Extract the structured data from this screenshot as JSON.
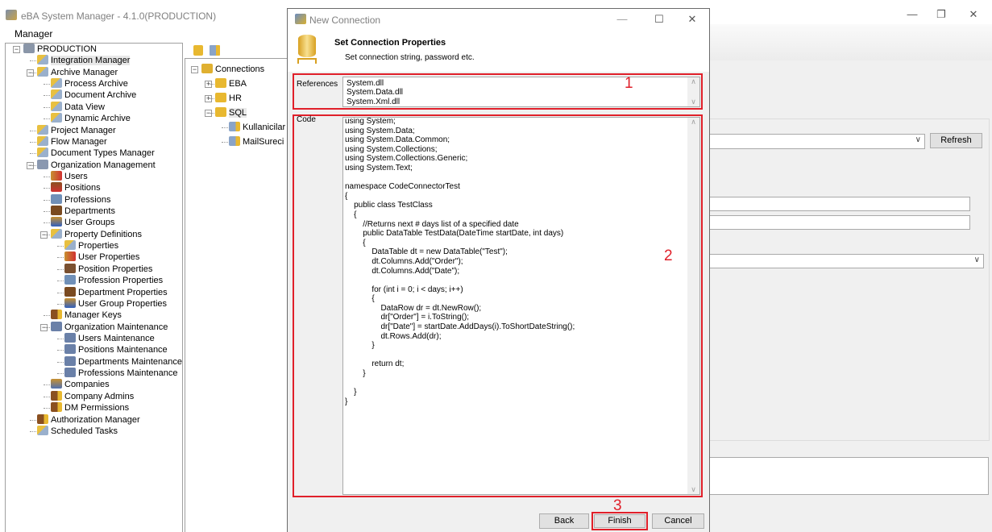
{
  "app": {
    "title": "eBA System Manager - 4.1.0(PRODUCTION)",
    "menu": [
      "Manager"
    ],
    "window_controls": [
      "minimize",
      "restore",
      "close"
    ]
  },
  "tree": [
    {
      "label": "PRODUCTION",
      "level": 0,
      "icon": "server-icon",
      "expanded": true
    },
    {
      "label": "Integration Manager",
      "level": 1,
      "icon": "module-icon",
      "selected": true
    },
    {
      "label": "Archive Manager",
      "level": 1,
      "icon": "module-icon",
      "expanded": true
    },
    {
      "label": "Process Archive",
      "level": 2,
      "icon": "module-icon"
    },
    {
      "label": "Document Archive",
      "level": 2,
      "icon": "module-icon"
    },
    {
      "label": "Data View",
      "level": 2,
      "icon": "module-icon"
    },
    {
      "label": "Dynamic Archive",
      "level": 2,
      "icon": "module-icon"
    },
    {
      "label": "Project Manager",
      "level": 1,
      "icon": "module-icon"
    },
    {
      "label": "Flow Manager",
      "level": 1,
      "icon": "module-icon"
    },
    {
      "label": "Document Types Manager",
      "level": 1,
      "icon": "module-icon"
    },
    {
      "label": "Organization Management",
      "level": 1,
      "icon": "organization-icon",
      "expanded": true
    },
    {
      "label": "Users",
      "level": 2,
      "icon": "users-icon"
    },
    {
      "label": "Positions",
      "level": 2,
      "icon": "positions-icon"
    },
    {
      "label": "Professions",
      "level": 2,
      "icon": "profession-card-icon"
    },
    {
      "label": "Departments",
      "level": 2,
      "icon": "departments-icon"
    },
    {
      "label": "User Groups",
      "level": 2,
      "icon": "user-groups-icon"
    },
    {
      "label": "Property Definitions",
      "level": 2,
      "icon": "module-icon",
      "expanded": true
    },
    {
      "label": "Properties",
      "level": 3,
      "icon": "module-icon"
    },
    {
      "label": "User Properties",
      "level": 3,
      "icon": "users-icon"
    },
    {
      "label": "Position Properties",
      "level": 3,
      "icon": "user-icon"
    },
    {
      "label": "Profession Properties",
      "level": 3,
      "icon": "profession-card-icon"
    },
    {
      "label": "Department Properties",
      "level": 3,
      "icon": "departments-icon"
    },
    {
      "label": "User Group Properties",
      "level": 3,
      "icon": "user-groups-icon"
    },
    {
      "label": "Manager Keys",
      "level": 2,
      "icon": "user-key-icon"
    },
    {
      "label": "Organization Maintenance",
      "level": 2,
      "icon": "gear-icon",
      "expanded": true
    },
    {
      "label": "Users Maintenance",
      "level": 3,
      "icon": "gear-icon"
    },
    {
      "label": "Positions Maintenance",
      "level": 3,
      "icon": "gear-icon"
    },
    {
      "label": "Departments Maintenance",
      "level": 3,
      "icon": "gear-icon"
    },
    {
      "label": "Professions Maintenance",
      "level": 3,
      "icon": "gear-icon"
    },
    {
      "label": "Companies",
      "level": 2,
      "icon": "companies-icon"
    },
    {
      "label": "Company Admins",
      "level": 2,
      "icon": "user-key-icon"
    },
    {
      "label": "DM Permissions",
      "level": 2,
      "icon": "user-key-icon"
    },
    {
      "label": "Authorization Manager",
      "level": 1,
      "icon": "user-key-icon"
    },
    {
      "label": "Scheduled Tasks",
      "level": 1,
      "icon": "module-icon"
    }
  ],
  "connections": {
    "toolbar": [
      "add-connection-icon",
      "add-table-icon"
    ],
    "tree": [
      {
        "label": "Connections",
        "level": 0,
        "icon": "databases-icon",
        "expanded": true
      },
      {
        "label": "EBA",
        "level": 1,
        "icon": "database-icon",
        "collapsed": true
      },
      {
        "label": "HR",
        "level": 1,
        "icon": "database-icon",
        "collapsed": true
      },
      {
        "label": "SQL",
        "level": 1,
        "icon": "database-icon",
        "expanded": true,
        "selected": true
      },
      {
        "label": "Kullanicilar",
        "level": 2,
        "icon": "table-icon"
      },
      {
        "label": "MailSureci",
        "level": 2,
        "icon": "table-icon"
      }
    ]
  },
  "right": {
    "refresh_label": "Refresh"
  },
  "dialog": {
    "title": "New Connection",
    "heading": "Set Connection Properties",
    "subheading": "Set connection string, password etc.",
    "references_label": "References",
    "references": "System.dll\nSystem.Data.dll\nSystem.Xml.dll",
    "code_label": "Code",
    "code": "using System;\nusing System.Data;\nusing System.Data.Common;\nusing System.Collections;\nusing System.Collections.Generic;\nusing System.Text;\n\nnamespace CodeConnectorTest\n{\n    public class TestClass\n    {\n        //Returns next # days list of a specified date\n        public DataTable TestData(DateTime startDate, int days)\n        {\n            DataTable dt = new DataTable(\"Test\");\n            dt.Columns.Add(\"Order\");\n            dt.Columns.Add(\"Date\");\n\n            for (int i = 0; i < days; i++)\n            {\n                DataRow dr = dt.NewRow();\n                dr[\"Order\"] = i.ToString();\n                dr[\"Date\"] = startDate.AddDays(i).ToShortDateString();\n                dt.Rows.Add(dr);\n            }\n\n            return dt;\n        }\n\n    }\n}",
    "back_label": "Back",
    "finish_label": "Finish",
    "cancel_label": "Cancel",
    "annotations": [
      "1",
      "2",
      "3"
    ]
  },
  "colors": {
    "annotation": "#e0202a",
    "window_bg": "#f0f0f0"
  }
}
